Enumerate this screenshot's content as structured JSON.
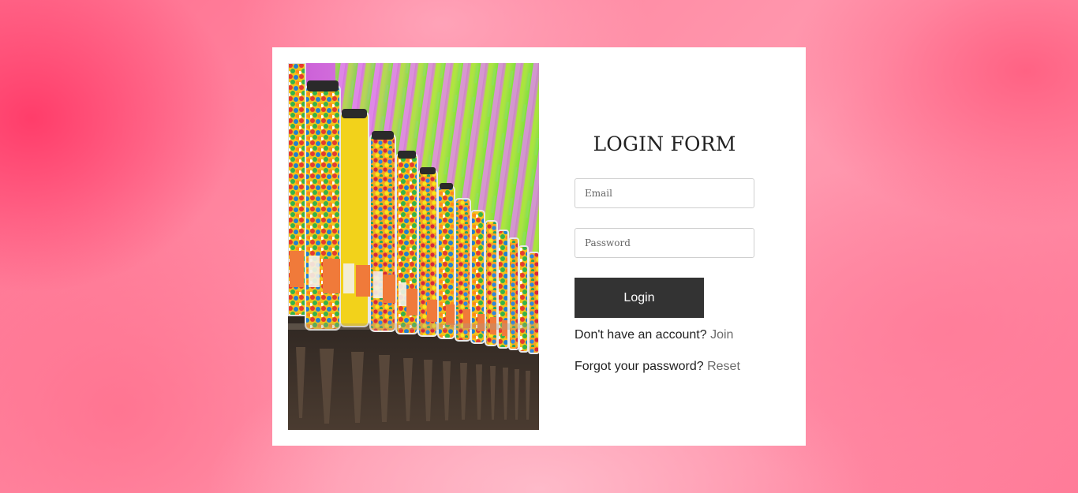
{
  "login": {
    "title": "LOGIN FORM",
    "email_placeholder": "Email",
    "password_placeholder": "Password",
    "button_label": "Login",
    "signup_prompt": "Don't have an account?",
    "signup_link": "Join",
    "forgot_prompt": "Forgot your password?",
    "forgot_link": "Reset"
  },
  "colors": {
    "button_bg": "#333333",
    "link": "#6b6b6b",
    "background_accent": "#ff6f8f"
  }
}
